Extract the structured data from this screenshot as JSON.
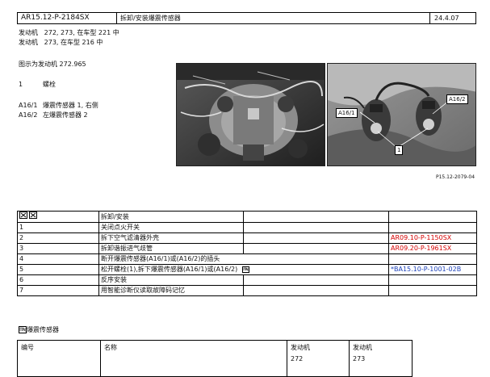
{
  "header": {
    "doc_id": "AR15.12-P-2184SX",
    "title": "拆卸/安装爆震传感器",
    "date": "24.4.07"
  },
  "engine_lines": [
    {
      "label": "发动机",
      "text": "272, 273, 在车型 221 中"
    },
    {
      "label": "发动机",
      "text": "273, 在车型 216 中"
    }
  ],
  "figure": {
    "caption": "图示为发动机 272.965",
    "legend": [
      {
        "key": "1",
        "text": "螺栓"
      },
      {
        "key": "A16/1",
        "text": "爆震传感器 1, 右侧"
      },
      {
        "key": "A16/2",
        "text": "左爆震传感器 2"
      }
    ],
    "callouts": {
      "a16_1": "A16/1",
      "a16_2": "A16/2",
      "one": "1"
    },
    "ref": "P15.12-2079-04"
  },
  "ops": {
    "header_label": "拆卸/安装",
    "rows": [
      {
        "num": "1",
        "text": "关闭点火开关",
        "ref": ""
      },
      {
        "num": "2",
        "text": "拆下空气滤清器外壳",
        "ref": "AR09.10-P-1150SX"
      },
      {
        "num": "3",
        "text": "拆卸谐振进气歧管",
        "ref": "AR09.20-P-1961SX"
      },
      {
        "num": "4",
        "text": "断开爆震传感器(A16/1)或(A16/2)的插头",
        "ref": ""
      },
      {
        "num": "5",
        "text": "松开螺栓(1),拆下爆震传感器(A16/1)或(A16/2)",
        "ref": "*BA15.10-P-1001-02B"
      },
      {
        "num": "6",
        "text": "反序安装",
        "ref": ""
      },
      {
        "num": "7",
        "text": "用智能诊断仪读取故障码记忆",
        "ref": ""
      }
    ]
  },
  "parts": {
    "section_title": "爆震传感器",
    "col_number": "编号",
    "col_name": "名称",
    "col_engine1": "发动机",
    "col_engine1_val": "272",
    "col_engine2": "发动机",
    "col_engine2_val": "273"
  },
  "colors": {
    "ref_red": "#d40000",
    "ref_blue": "#1a3fb8"
  }
}
